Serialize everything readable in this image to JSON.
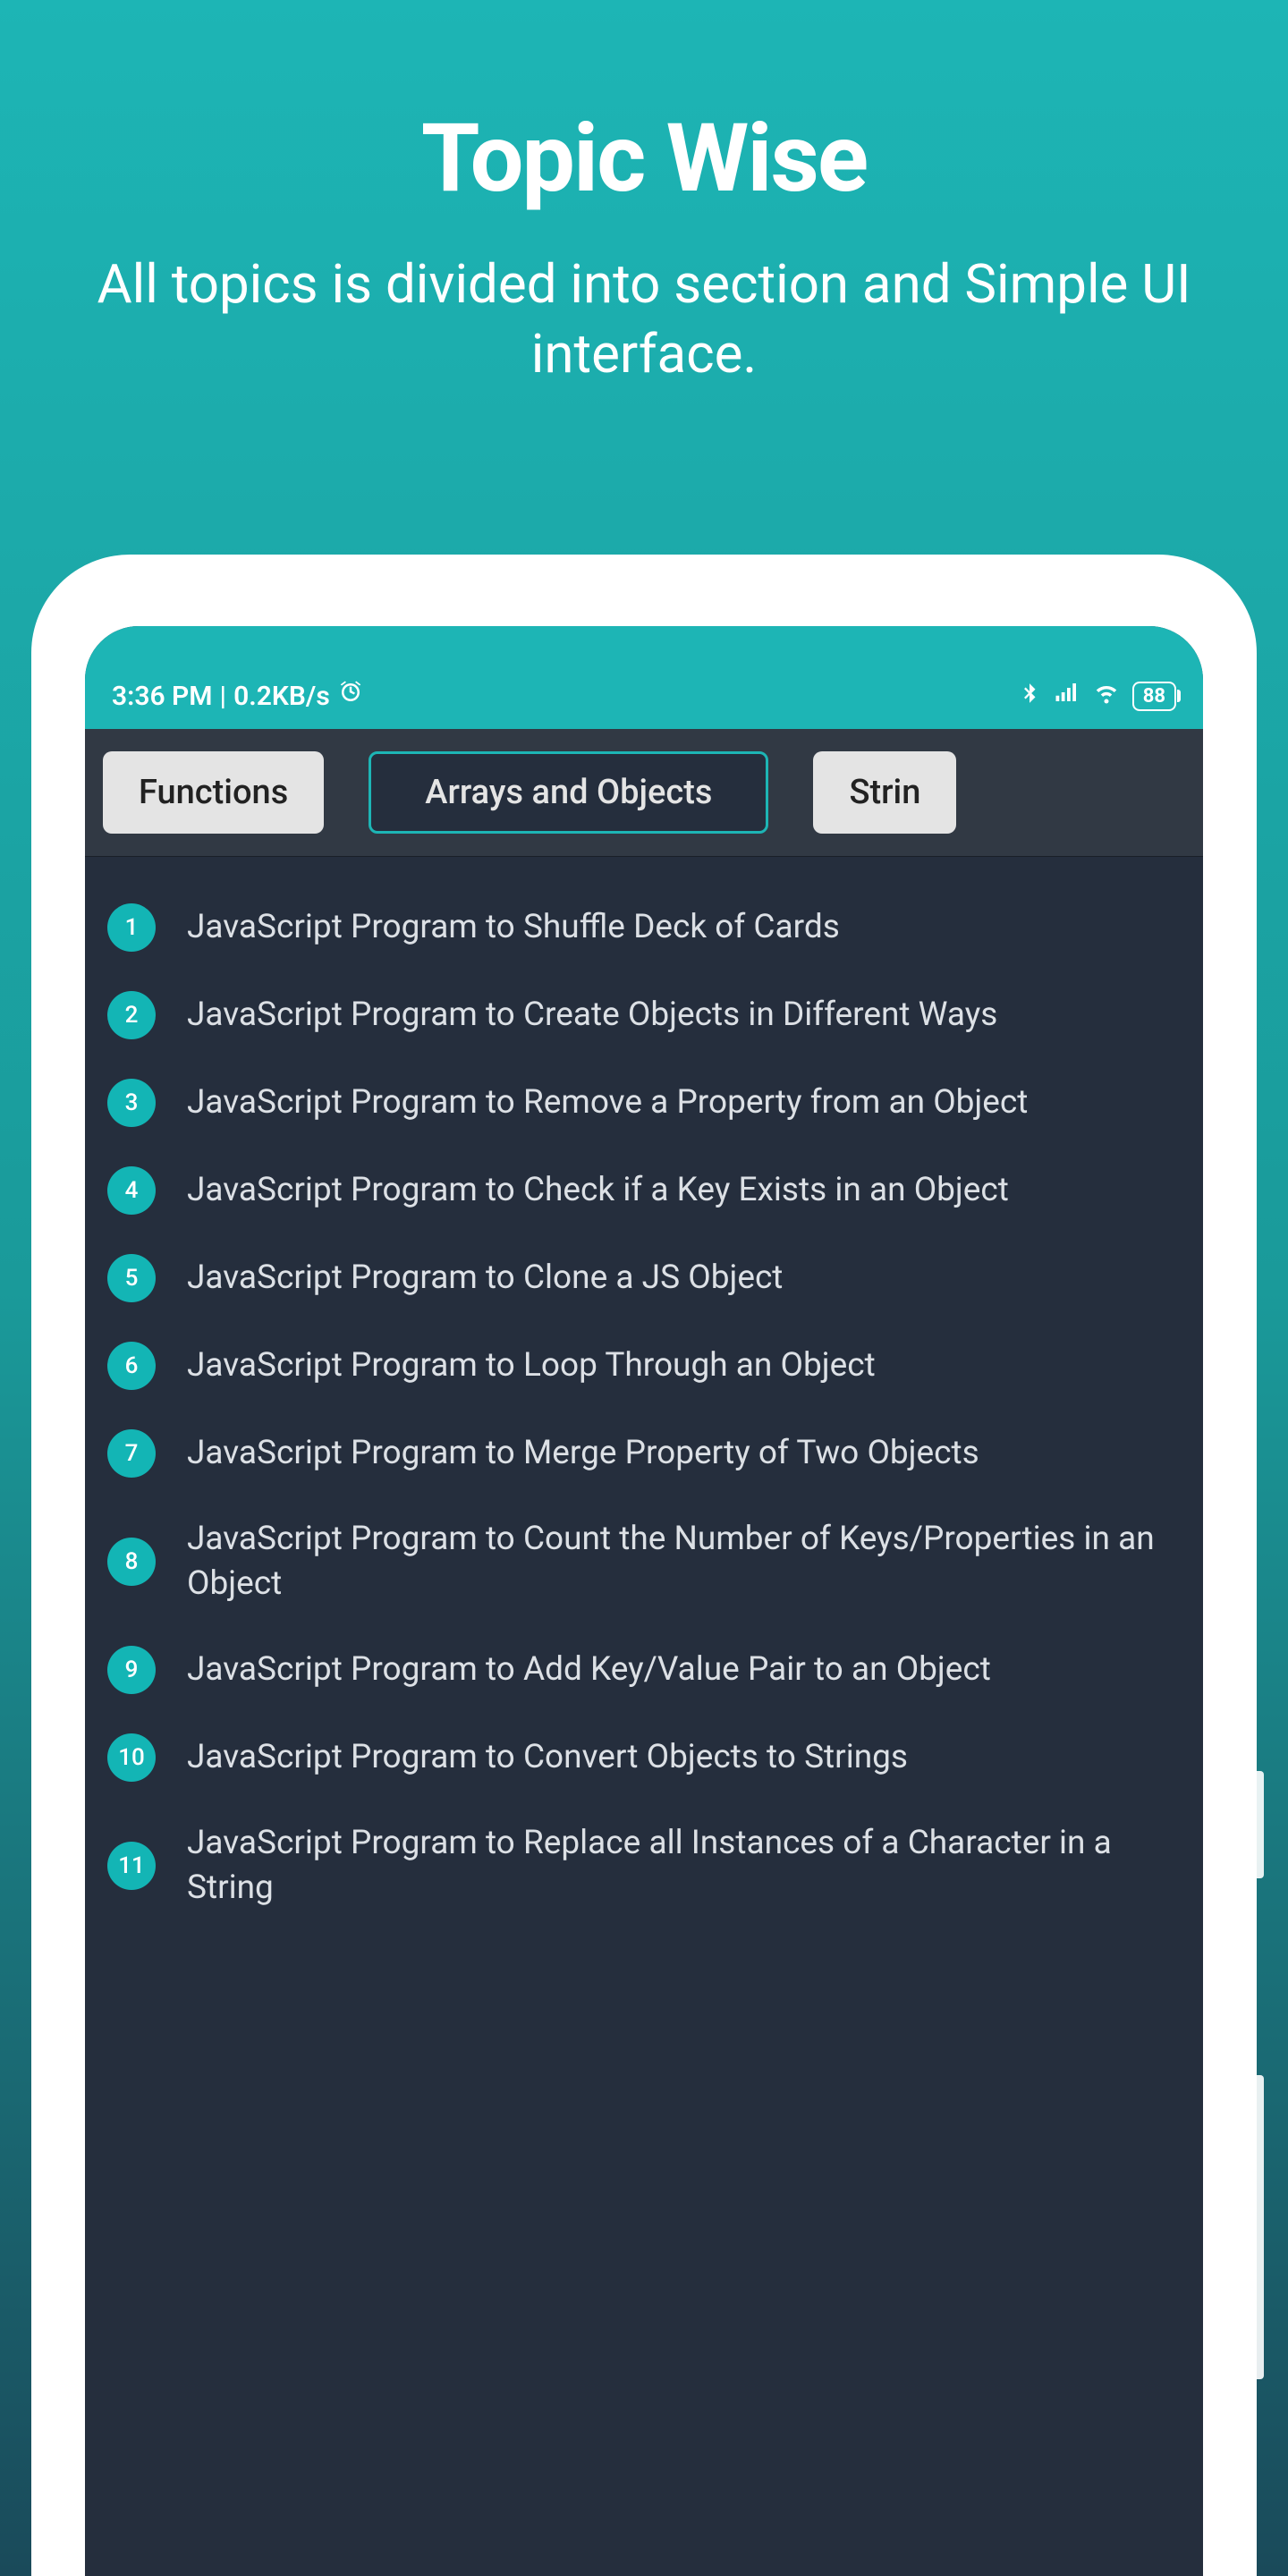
{
  "promo": {
    "title": "Topic Wise",
    "subtitle": "All topics is divided into section and Simple UI interface."
  },
  "status_bar": {
    "time": "3:36 PM",
    "speed": "0.2KB/s",
    "battery": "88"
  },
  "tabs": [
    {
      "label": "Functions",
      "active": false
    },
    {
      "label": "Arrays and Objects",
      "active": true
    },
    {
      "label": "Strin",
      "active": false
    }
  ],
  "list_items": [
    {
      "num": "1",
      "title": "JavaScript Program to Shuffle Deck of Cards"
    },
    {
      "num": "2",
      "title": "JavaScript Program to Create Objects in Different Ways"
    },
    {
      "num": "3",
      "title": "JavaScript Program to Remove a Property from an Object"
    },
    {
      "num": "4",
      "title": "JavaScript Program to Check if a Key Exists in an Object"
    },
    {
      "num": "5",
      "title": "JavaScript Program to Clone a JS Object"
    },
    {
      "num": "6",
      "title": "JavaScript Program to Loop Through an Object"
    },
    {
      "num": "7",
      "title": "JavaScript Program to Merge Property of Two Objects"
    },
    {
      "num": "8",
      "title": "JavaScript Program to Count the Number of Keys/Properties in an Object"
    },
    {
      "num": "9",
      "title": "JavaScript Program to Add Key/Value Pair to an Object"
    },
    {
      "num": "10",
      "title": "JavaScript Program to Convert Objects to Strings"
    },
    {
      "num": "11",
      "title": "JavaScript Program to Replace all Instances of a Character in a String"
    }
  ]
}
